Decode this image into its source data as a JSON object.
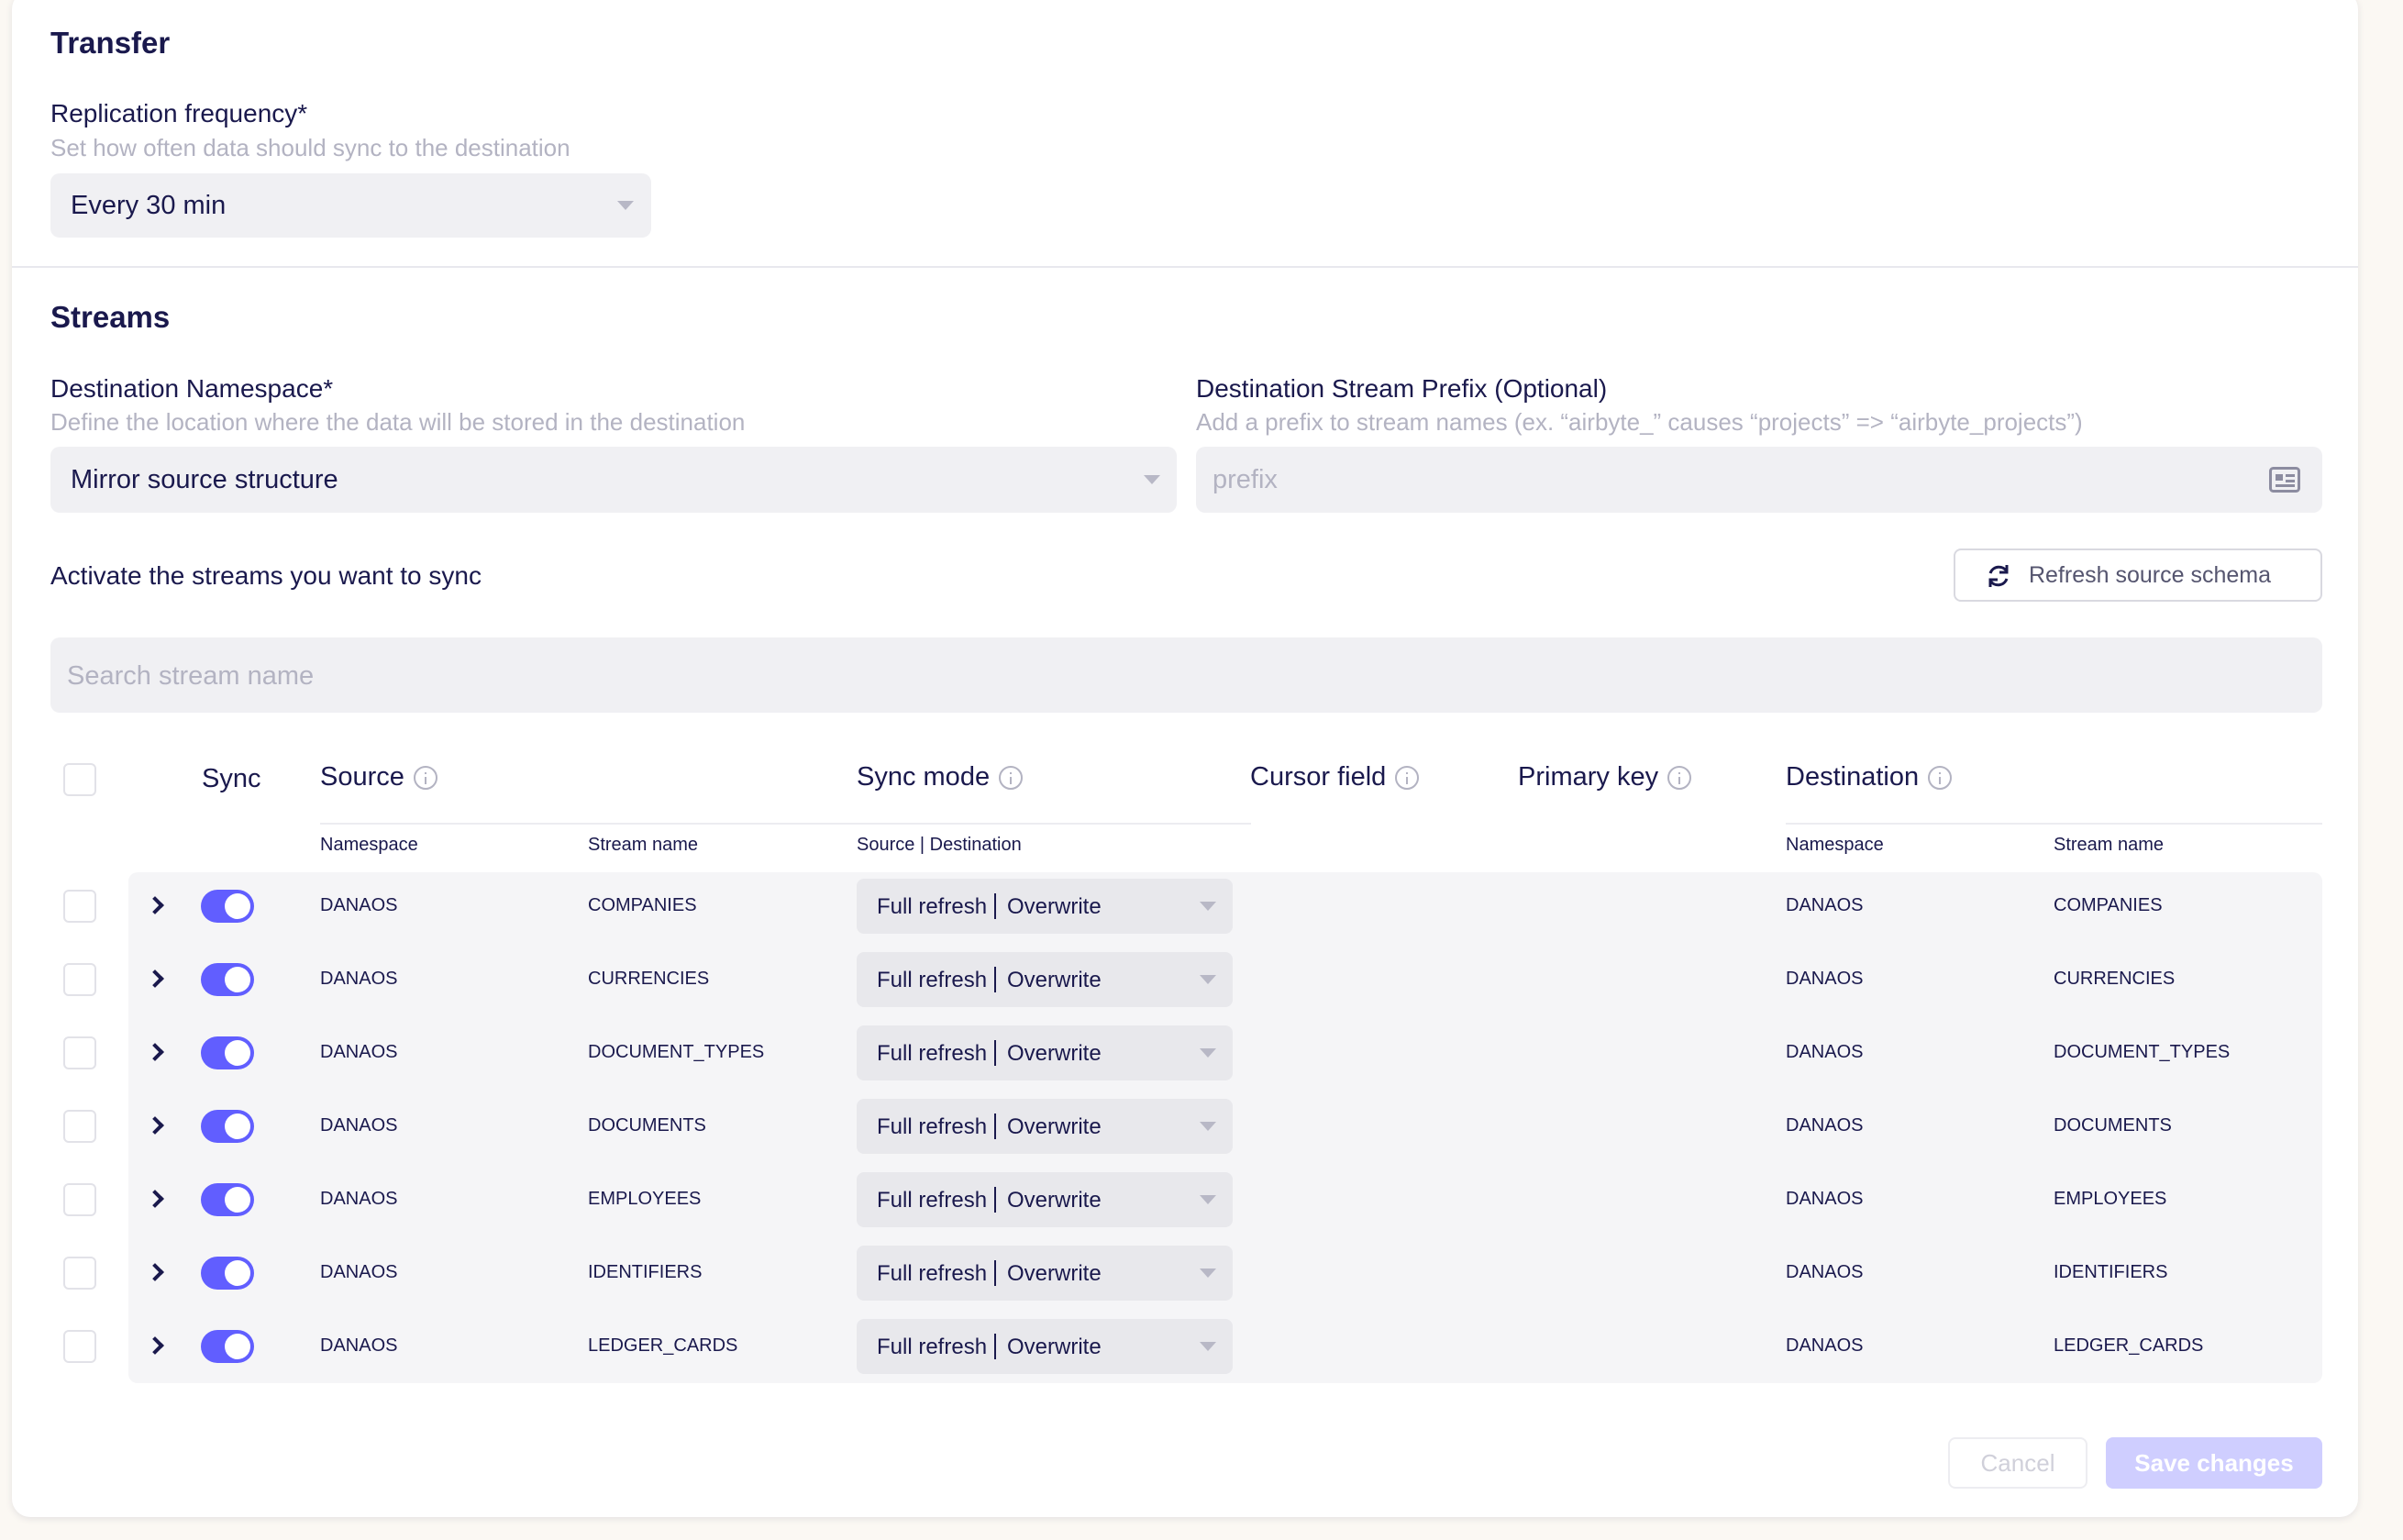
{
  "transfer": {
    "title": "Transfer",
    "replication_label": "Replication frequency*",
    "replication_hint": "Set how often data should sync to the destination",
    "replication_value": "Every 30 min"
  },
  "streams": {
    "title": "Streams",
    "namespace_label": "Destination Namespace*",
    "namespace_hint": "Define the location where the data will be stored in the destination",
    "namespace_value": "Mirror source structure",
    "prefix_label": "Destination Stream Prefix (Optional)",
    "prefix_hint": "Add a prefix to stream names (ex. “airbyte_” causes “projects” => “airbyte_projects”)",
    "prefix_placeholder": "prefix",
    "activate_label": "Activate the streams you want to sync",
    "refresh_label": "Refresh source schema",
    "search_placeholder": "Search stream name"
  },
  "table": {
    "headers": {
      "sync": "Sync",
      "source": "Source",
      "sync_mode": "Sync mode",
      "cursor_field": "Cursor field",
      "primary_key": "Primary key",
      "destination": "Destination"
    },
    "subheaders": {
      "source_namespace": "Namespace",
      "source_stream": "Stream name",
      "sync_mode": "Source | Destination",
      "dest_namespace": "Namespace",
      "dest_stream": "Stream name"
    },
    "rows": [
      {
        "namespace": "DANAOS",
        "stream": "COMPANIES",
        "mode_source": "Full refresh",
        "mode_dest": "Overwrite",
        "dest_namespace": "DANAOS",
        "dest_stream": "COMPANIES",
        "sync": true
      },
      {
        "namespace": "DANAOS",
        "stream": "CURRENCIES",
        "mode_source": "Full refresh",
        "mode_dest": "Overwrite",
        "dest_namespace": "DANAOS",
        "dest_stream": "CURRENCIES",
        "sync": true
      },
      {
        "namespace": "DANAOS",
        "stream": "DOCUMENT_TYPES",
        "mode_source": "Full refresh",
        "mode_dest": "Overwrite",
        "dest_namespace": "DANAOS",
        "dest_stream": "DOCUMENT_TYPES",
        "sync": true
      },
      {
        "namespace": "DANAOS",
        "stream": "DOCUMENTS",
        "mode_source": "Full refresh",
        "mode_dest": "Overwrite",
        "dest_namespace": "DANAOS",
        "dest_stream": "DOCUMENTS",
        "sync": true
      },
      {
        "namespace": "DANAOS",
        "stream": "EMPLOYEES",
        "mode_source": "Full refresh",
        "mode_dest": "Overwrite",
        "dest_namespace": "DANAOS",
        "dest_stream": "EMPLOYEES",
        "sync": true
      },
      {
        "namespace": "DANAOS",
        "stream": "IDENTIFIERS",
        "mode_source": "Full refresh",
        "mode_dest": "Overwrite",
        "dest_namespace": "DANAOS",
        "dest_stream": "IDENTIFIERS",
        "sync": true
      },
      {
        "namespace": "DANAOS",
        "stream": "LEDGER_CARDS",
        "mode_source": "Full refresh",
        "mode_dest": "Overwrite",
        "dest_namespace": "DANAOS",
        "dest_stream": "LEDGER_CARDS",
        "sync": true
      }
    ]
  },
  "footer": {
    "cancel_label": "Cancel",
    "save_label": "Save changes"
  },
  "colors": {
    "accent": "#615eff",
    "text": "#1a194d",
    "hint": "#b3b3c2",
    "field_bg": "#f0f0f3"
  }
}
